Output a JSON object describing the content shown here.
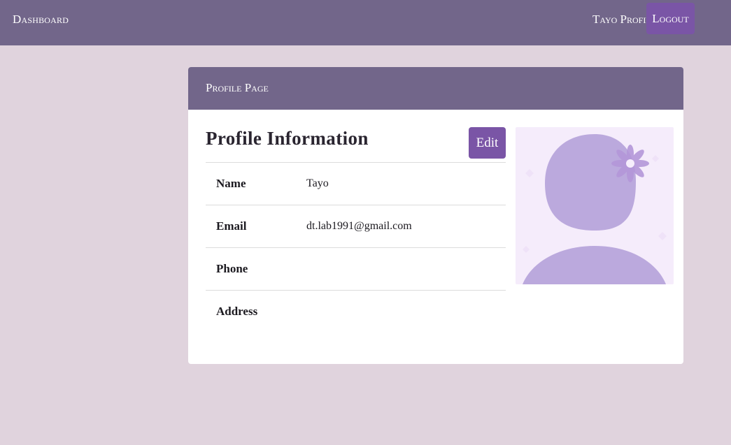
{
  "navbar": {
    "brand": "Dashboard",
    "profile_link": "Tayo Profile",
    "logout_label": "Logout"
  },
  "card": {
    "header_title": "Profile Page",
    "section_title": "Profile Information",
    "edit_label": "Edit",
    "fields": [
      {
        "label": "Name",
        "value": "Tayo"
      },
      {
        "label": "Email",
        "value": "dt.lab1991@gmail.com"
      },
      {
        "label": "Phone",
        "value": ""
      },
      {
        "label": "Address",
        "value": ""
      }
    ],
    "avatar_icon": "user-avatar-with-flower"
  },
  "colors": {
    "navbar_bg": "#72668a",
    "page_bg": "#e0d3dd",
    "button_bg": "#7a55a6",
    "avatar_bg": "#f5ecfb",
    "avatar_figure": "#bba9dd"
  }
}
